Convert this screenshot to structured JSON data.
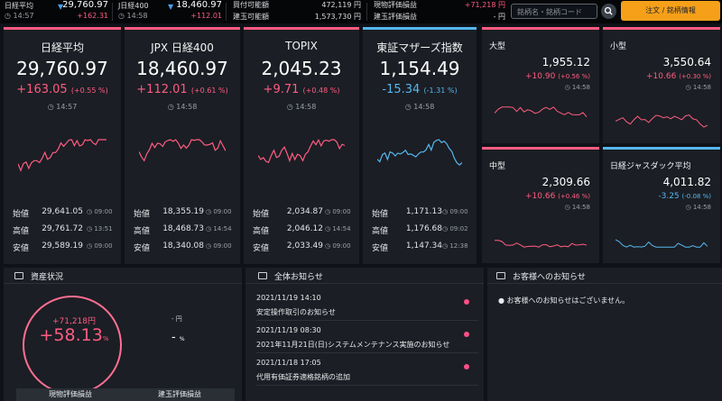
{
  "topbar": {
    "mini": [
      {
        "label": "日経平均",
        "value": "29,760.97",
        "time": "14:57",
        "change": "+162.31"
      },
      {
        "label": "J日経400",
        "value": "18,460.97",
        "time": "14:58",
        "change": "+112.01"
      }
    ],
    "account": {
      "buying_power_label": "買付可能額",
      "buying_power_value": "472,119 円",
      "margin_power_label": "建玉可能額",
      "margin_power_value": "1,573,730 円",
      "spot_pl_label": "現物評価損益",
      "spot_pl_value": "+71,218 円",
      "margin_pl_label": "建玉評価損益",
      "margin_pl_value": "- 円"
    },
    "search_placeholder": "銘柄名・銘柄コード",
    "order_button": "注文 / 銘柄情報"
  },
  "cards": [
    {
      "name": "日経平均",
      "value": "29,760.97",
      "change": "+163.05",
      "pct": "(+0.55 %)",
      "time": "14:57",
      "ohl": [
        {
          "k": "始値",
          "v": "29,641.05",
          "t": "09:00"
        },
        {
          "k": "高値",
          "v": "29,761.72",
          "t": "13:51"
        },
        {
          "k": "安値",
          "v": "29,589.19",
          "t": "09:00"
        }
      ]
    },
    {
      "name": "JPX 日経400",
      "value": "18,460.97",
      "change": "+112.01",
      "pct": "(+0.61 %)",
      "time": "14:58",
      "ohl": [
        {
          "k": "始値",
          "v": "18,355.19",
          "t": "09:00"
        },
        {
          "k": "高値",
          "v": "18,468.73",
          "t": "14:54"
        },
        {
          "k": "安値",
          "v": "18,340.08",
          "t": "09:00"
        }
      ]
    },
    {
      "name": "TOPIX",
      "value": "2,045.23",
      "change": "+9.71",
      "pct": "(+0.48 %)",
      "time": "14:58",
      "ohl": [
        {
          "k": "始値",
          "v": "2,034.87",
          "t": "09:00"
        },
        {
          "k": "高値",
          "v": "2,046.12",
          "t": "14:54"
        },
        {
          "k": "安値",
          "v": "2,033.49",
          "t": "09:00"
        }
      ]
    },
    {
      "name": "東証マザーズ指数",
      "value": "1,154.49",
      "change": "-15.34",
      "pct": "(-1.31 %)",
      "time": "14:58",
      "ohl": [
        {
          "k": "始値",
          "v": "1,171.13",
          "t": "09:00"
        },
        {
          "k": "高値",
          "v": "1,176.68",
          "t": "09:02"
        },
        {
          "k": "安値",
          "v": "1,147.34",
          "t": "12:38"
        }
      ]
    }
  ],
  "small_cards": [
    {
      "name": "大型",
      "value": "1,955.12",
      "change": "+10.90",
      "pct": "(+0.56 %)",
      "time": "14:58"
    },
    {
      "name": "小型",
      "value": "3,550.64",
      "change": "+10.66",
      "pct": "(+0.30 %)",
      "time": "14:58"
    },
    {
      "name": "中型",
      "value": "2,309.66",
      "change": "+10.66",
      "pct": "(+0.46 %)",
      "time": "14:58"
    },
    {
      "name": "日経ジャスダック平均",
      "value": "4,011.82",
      "change": "-3.25",
      "pct": "(-0.08 %)",
      "time": "14:58"
    }
  ],
  "assets": {
    "title": "資産状況",
    "amount": "+71,218円",
    "percent": "+58.13",
    "percent_unit": "%",
    "right_amount": "- 円",
    "right_percent": "-",
    "right_percent_unit": "%",
    "footer_left": "現物評価損益",
    "footer_right": "建玉評価損益"
  },
  "news": {
    "title": "全体お知らせ",
    "items": [
      {
        "date": "2021/11/19 14:10",
        "title": "安定操作取引のお知らせ"
      },
      {
        "date": "2021/11/19 08:30",
        "title": "2021年11月21日(日)システムメンテナンス実施のお知らせ"
      },
      {
        "date": "2021/11/18 17:05",
        "title": "代用有価証券適格銘柄の追加"
      }
    ]
  },
  "customer_news": {
    "title": "お客様へのお知らせ",
    "message": "お客様へのお知らせはございません。"
  },
  "colors": {
    "up": "#ff5c82",
    "down": "#55b7f0",
    "accent": "#f6a019",
    "card": "#1b1e24"
  }
}
